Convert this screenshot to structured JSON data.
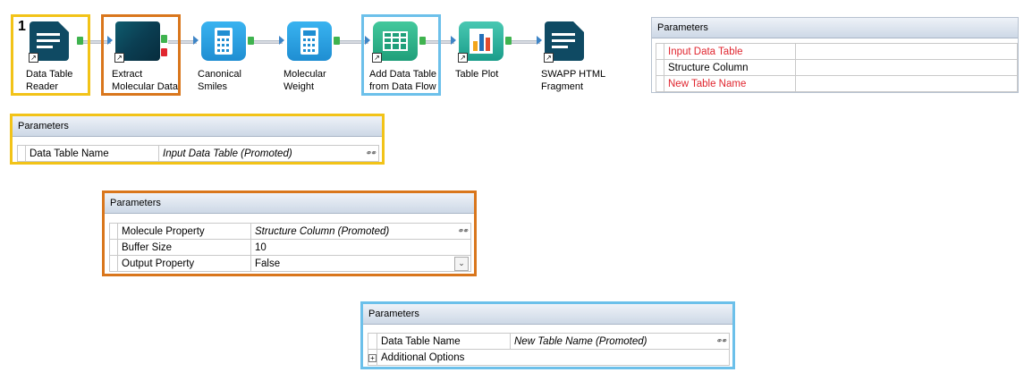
{
  "workflow": {
    "nodes": [
      {
        "id": "n1",
        "label_l1": "Data Table",
        "label_l2": "Reader",
        "icon": "document-icon",
        "badge": "1"
      },
      {
        "id": "n2",
        "label_l1": "Extract",
        "label_l2": "Molecular Data",
        "icon": "molecule-icon"
      },
      {
        "id": "n3",
        "label_l1": "Canonical",
        "label_l2": "Smiles",
        "icon": "calculator-icon"
      },
      {
        "id": "n4",
        "label_l1": "Molecular",
        "label_l2": "Weight",
        "icon": "calculator-icon"
      },
      {
        "id": "n5",
        "label_l1": "Add Data Table",
        "label_l2": "from Data Flow",
        "icon": "table-icon"
      },
      {
        "id": "n6",
        "label_l1": "Table Plot",
        "label_l2": "",
        "icon": "bar-chart-icon"
      },
      {
        "id": "n7",
        "label_l1": "SWAPP HTML",
        "label_l2": "Fragment",
        "icon": "document-icon"
      }
    ],
    "colors": {
      "yellow": "#f2c318",
      "orange": "#d9761c",
      "blue": "#6cc0ea"
    }
  },
  "panel_main": {
    "title": "Parameters",
    "rows": [
      {
        "name": "Input Data Table",
        "value": "",
        "red": true
      },
      {
        "name": "Structure Column",
        "value": "",
        "red": false
      },
      {
        "name": "New Table Name",
        "value": "",
        "red": true
      }
    ]
  },
  "panel_yellow": {
    "title": "Parameters",
    "rows": [
      {
        "name": "Data Table Name",
        "value": "Input Data Table (Promoted)"
      }
    ]
  },
  "panel_orange": {
    "title": "Parameters",
    "rows": [
      {
        "name": "Molecule Property",
        "value": "Structure Column (Promoted)"
      },
      {
        "name": "Buffer Size",
        "value": "10"
      },
      {
        "name": "Output Property",
        "value": "False"
      }
    ]
  },
  "panel_blue": {
    "title": "Parameters",
    "rows": [
      {
        "name": "Data Table Name",
        "value": "New Table Name (Promoted)"
      },
      {
        "name": "Additional Options",
        "value": ""
      }
    ],
    "expand_glyph": "+"
  }
}
